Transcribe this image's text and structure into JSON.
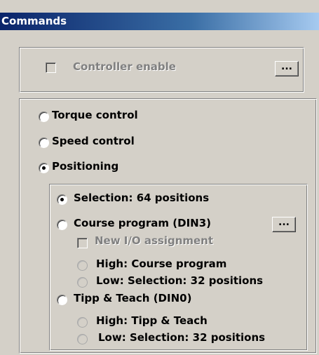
{
  "window": {
    "title": "Commands"
  },
  "enable_group": {
    "controller_enable_label": "Controller enable",
    "controller_enable_checked": false,
    "dots_label": "..."
  },
  "mode_group": {
    "options": [
      {
        "label": "Torque control",
        "selected": false
      },
      {
        "label": "Speed control",
        "selected": false
      },
      {
        "label": "Positioning",
        "selected": true
      }
    ]
  },
  "positioning_group": {
    "selection_label": "Selection: 64 positions",
    "course_program_label": "Course program (DIN3)",
    "course_dots_label": "...",
    "new_io_label": "New I/O assignment",
    "course_high_label": "High: Course program",
    "course_low_label": "Low: Selection: 32 positions",
    "tipp_teach_label": "Tipp & Teach (DIN0)",
    "tipp_high_label": "High: Tipp & Teach",
    "tipp_low_label": "Low: Selection: 32 positions",
    "selected": "Selection: 64 positions"
  }
}
